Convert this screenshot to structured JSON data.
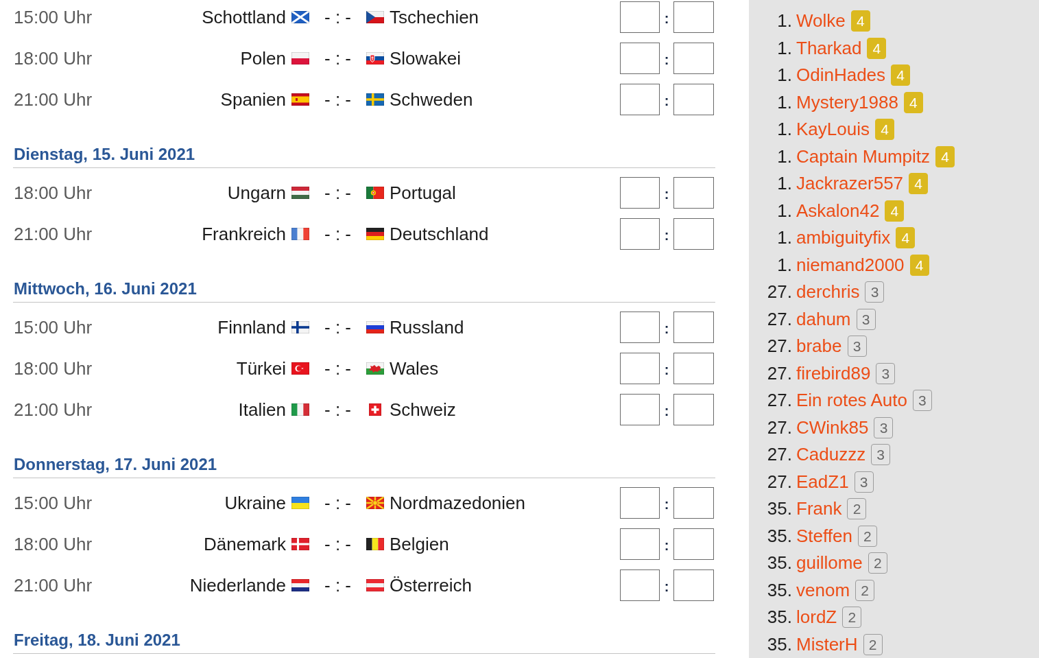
{
  "schedule": {
    "days": [
      {
        "matches": [
          {
            "time": "15:00 Uhr",
            "home": "Schottland",
            "score": "- : -",
            "away": "Tschechien",
            "separator": ":"
          },
          {
            "time": "18:00 Uhr",
            "home": "Polen",
            "score": "- : -",
            "away": "Slowakei",
            "separator": ":"
          },
          {
            "time": "21:00 Uhr",
            "home": "Spanien",
            "score": "- : -",
            "away": "Schweden",
            "separator": ":"
          }
        ]
      },
      {
        "heading": "Dienstag, 15. Juni 2021",
        "matches": [
          {
            "time": "18:00 Uhr",
            "home": "Ungarn",
            "score": "- : -",
            "away": "Portugal",
            "separator": ":"
          },
          {
            "time": "21:00 Uhr",
            "home": "Frankreich",
            "score": "- : -",
            "away": "Deutschland",
            "separator": ":"
          }
        ]
      },
      {
        "heading": "Mittwoch, 16. Juni 2021",
        "matches": [
          {
            "time": "15:00 Uhr",
            "home": "Finnland",
            "score": "- : -",
            "away": "Russland",
            "separator": ":"
          },
          {
            "time": "18:00 Uhr",
            "home": "Türkei",
            "score": "- : -",
            "away": "Wales",
            "separator": ":"
          },
          {
            "time": "21:00 Uhr",
            "home": "Italien",
            "score": "- : -",
            "away": "Schweiz",
            "separator": ":"
          }
        ]
      },
      {
        "heading": "Donnerstag, 17. Juni 2021",
        "matches": [
          {
            "time": "15:00 Uhr",
            "home": "Ukraine",
            "score": "- : -",
            "away": "Nordmazedonien",
            "separator": ":"
          },
          {
            "time": "18:00 Uhr",
            "home": "Dänemark",
            "score": "- : -",
            "away": "Belgien",
            "separator": ":"
          },
          {
            "time": "21:00 Uhr",
            "home": "Niederlande",
            "score": "- : -",
            "away": "Österreich",
            "separator": ":"
          }
        ]
      },
      {
        "heading": "Freitag, 18. Juni 2021"
      }
    ]
  },
  "leaderboard": {
    "entries": [
      {
        "rank": "1.",
        "name": "Wolke",
        "points": "4",
        "highlighted": true
      },
      {
        "rank": "1.",
        "name": "Tharkad",
        "points": "4",
        "highlighted": true
      },
      {
        "rank": "1.",
        "name": "OdinHades",
        "points": "4",
        "highlighted": true
      },
      {
        "rank": "1.",
        "name": "Mystery1988",
        "points": "4",
        "highlighted": true
      },
      {
        "rank": "1.",
        "name": "KayLouis",
        "points": "4",
        "highlighted": true
      },
      {
        "rank": "1.",
        "name": "Captain Mumpitz",
        "points": "4",
        "highlighted": true
      },
      {
        "rank": "1.",
        "name": "Jackrazer557",
        "points": "4",
        "highlighted": true
      },
      {
        "rank": "1.",
        "name": "Askalon42",
        "points": "4",
        "highlighted": true
      },
      {
        "rank": "1.",
        "name": "ambiguityfix",
        "points": "4",
        "highlighted": true
      },
      {
        "rank": "1.",
        "name": "niemand2000",
        "points": "4",
        "highlighted": true
      },
      {
        "rank": "27.",
        "name": "derchris",
        "points": "3",
        "highlighted": false
      },
      {
        "rank": "27.",
        "name": "dahum",
        "points": "3",
        "highlighted": false
      },
      {
        "rank": "27.",
        "name": "brabe",
        "points": "3",
        "highlighted": false
      },
      {
        "rank": "27.",
        "name": "firebird89",
        "points": "3",
        "highlighted": false
      },
      {
        "rank": "27.",
        "name": "Ein rotes Auto",
        "points": "3",
        "highlighted": false
      },
      {
        "rank": "27.",
        "name": "CWink85",
        "points": "3",
        "highlighted": false
      },
      {
        "rank": "27.",
        "name": "Caduzzz",
        "points": "3",
        "highlighted": false
      },
      {
        "rank": "27.",
        "name": "EadZ1",
        "points": "3",
        "highlighted": false
      },
      {
        "rank": "35.",
        "name": "Frank",
        "points": "2",
        "highlighted": false
      },
      {
        "rank": "35.",
        "name": "Steffen",
        "points": "2",
        "highlighted": false
      },
      {
        "rank": "35.",
        "name": "guillome",
        "points": "2",
        "highlighted": false
      },
      {
        "rank": "35.",
        "name": "venom",
        "points": "2",
        "highlighted": false
      },
      {
        "rank": "35.",
        "name": "lordZ",
        "points": "2",
        "highlighted": false
      },
      {
        "rank": "35.",
        "name": "MisterH",
        "points": "2",
        "highlighted": false
      }
    ]
  }
}
